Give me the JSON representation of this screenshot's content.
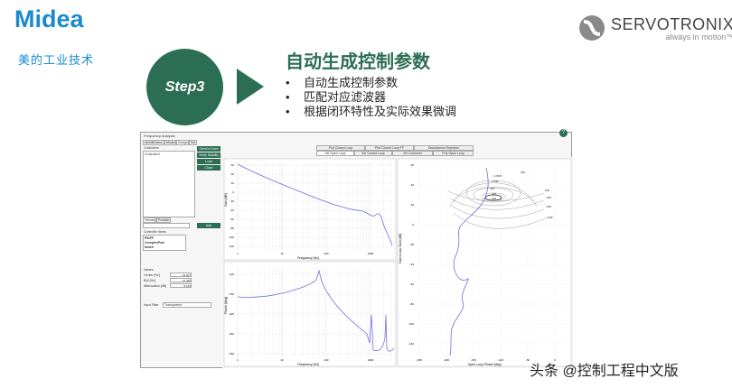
{
  "logo": {
    "brand": "Midea",
    "subtitle": "美的工业技术"
  },
  "partner": {
    "name": "SERVOTRONIX",
    "tagline": "always in motion™"
  },
  "step": {
    "label": "Step3",
    "title": "自动生成控制参数",
    "bullets": [
      "自动生成控制参数",
      "匹配对应滤波器",
      "根据闭环特性及实际效果微调"
    ]
  },
  "app": {
    "title": "Frequency Analysis",
    "help": "?",
    "left_tabs": [
      "Identification",
      "Model",
      "Design",
      "Set"
    ],
    "controllers_label": "Controllers",
    "controller_item": "Controller1",
    "buttons": [
      "Send to Drive",
      "Verify Stability",
      "Load",
      "Close"
    ],
    "sub_tabs": [
      "Velocity",
      "Position"
    ],
    "add_label": "Add",
    "items_label": "Controller items",
    "items": [
      "PIDFF",
      "ComplexPole",
      "Notch"
    ],
    "values_label": "Values",
    "value_fields": [
      {
        "label": "Center [Hz]",
        "value": "92.907"
      },
      {
        "label": "BW [Hz]",
        "value": "21.465"
      },
      {
        "label": "Attenuation [dB]",
        "value": "-8.635"
      }
    ],
    "input_filter_label": "Input Filter",
    "input_filter_value": "Transparent",
    "plot_tabs_top": [
      "Plot Closed Loop",
      "Plot Closed Loop FF",
      "Disturbance Rejection"
    ],
    "plot_tabs_bottom": [
      "Vel Open Loop",
      "Vel Closed Loop",
      "Vel Controller",
      "Pos Open Loop"
    ],
    "bode_mag": {
      "ylabel": "Gain [dB]",
      "xlabel": "Frequency [Hz]",
      "yticks": [
        "60",
        "40",
        "20",
        "0",
        "-20",
        "-40",
        "-60",
        "-80",
        "-100",
        "-120"
      ],
      "xticks": [
        "1",
        "10",
        "100",
        "1000"
      ]
    },
    "bode_phase": {
      "ylabel": "Phase [deg]",
      "xlabel": "Frequency [Hz]",
      "yticks": [
        "-100",
        "-150",
        "-200",
        "-250",
        "-300"
      ],
      "xticks": [
        "1",
        "10",
        "100",
        "1000"
      ]
    },
    "nichols": {
      "ylabel": "Open Loop Gain [dB]",
      "xlabel": "Open Loop Phase [deg]",
      "xticks": [
        "-250",
        "-200",
        "-150",
        "-100",
        "-50",
        "0"
      ],
      "yticks": [
        "60",
        "40",
        "20",
        "0",
        "-20",
        "-40",
        "-60",
        "-80",
        "-100",
        "-120"
      ],
      "contours": [
        "0dB",
        "0.25dB",
        "0.5dB",
        "1dB",
        "3dB",
        "6dB",
        "-1dB",
        "-3dB",
        "-6dB",
        "-12dB"
      ]
    }
  },
  "watermark": "头条 @控制工程中文版",
  "colors": {
    "brand_blue": "#1a8ad0",
    "accent_green": "#2c6e53",
    "plot_line": "#6a6fe0"
  }
}
